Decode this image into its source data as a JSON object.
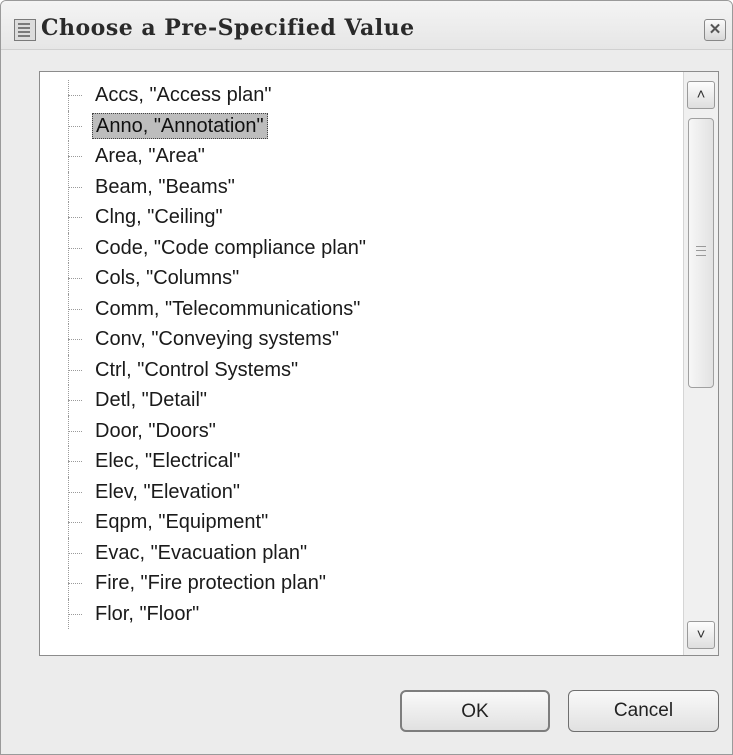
{
  "dialog": {
    "title": "Choose a Pre-Specified Value",
    "close_label": "✕"
  },
  "list": {
    "selected_index": 1,
    "items": [
      {
        "label": "Accs, \"Access plan\""
      },
      {
        "label": "Anno, \"Annotation\""
      },
      {
        "label": "Area, \"Area\""
      },
      {
        "label": "Beam, \"Beams\""
      },
      {
        "label": "Clng, \"Ceiling\""
      },
      {
        "label": "Code, \"Code compliance plan\""
      },
      {
        "label": "Cols, \"Columns\""
      },
      {
        "label": "Comm, \"Telecommunications\""
      },
      {
        "label": "Conv, \"Conveying systems\""
      },
      {
        "label": "Ctrl, \"Control Systems\""
      },
      {
        "label": "Detl, \"Detail\""
      },
      {
        "label": "Door, \"Doors\""
      },
      {
        "label": "Elec, \"Electrical\""
      },
      {
        "label": "Elev, \"Elevation\""
      },
      {
        "label": "Eqpm, \"Equipment\""
      },
      {
        "label": "Evac, \"Evacuation plan\""
      },
      {
        "label": "Fire, \"Fire protection plan\""
      },
      {
        "label": "Flor, \"Floor\""
      }
    ]
  },
  "scrollbar": {
    "up_icon": "chevron-up-icon",
    "down_icon": "chevron-down-icon",
    "up_glyph": "˄",
    "down_glyph": "˅"
  },
  "buttons": {
    "ok_label": "OK",
    "cancel_label": "Cancel"
  }
}
